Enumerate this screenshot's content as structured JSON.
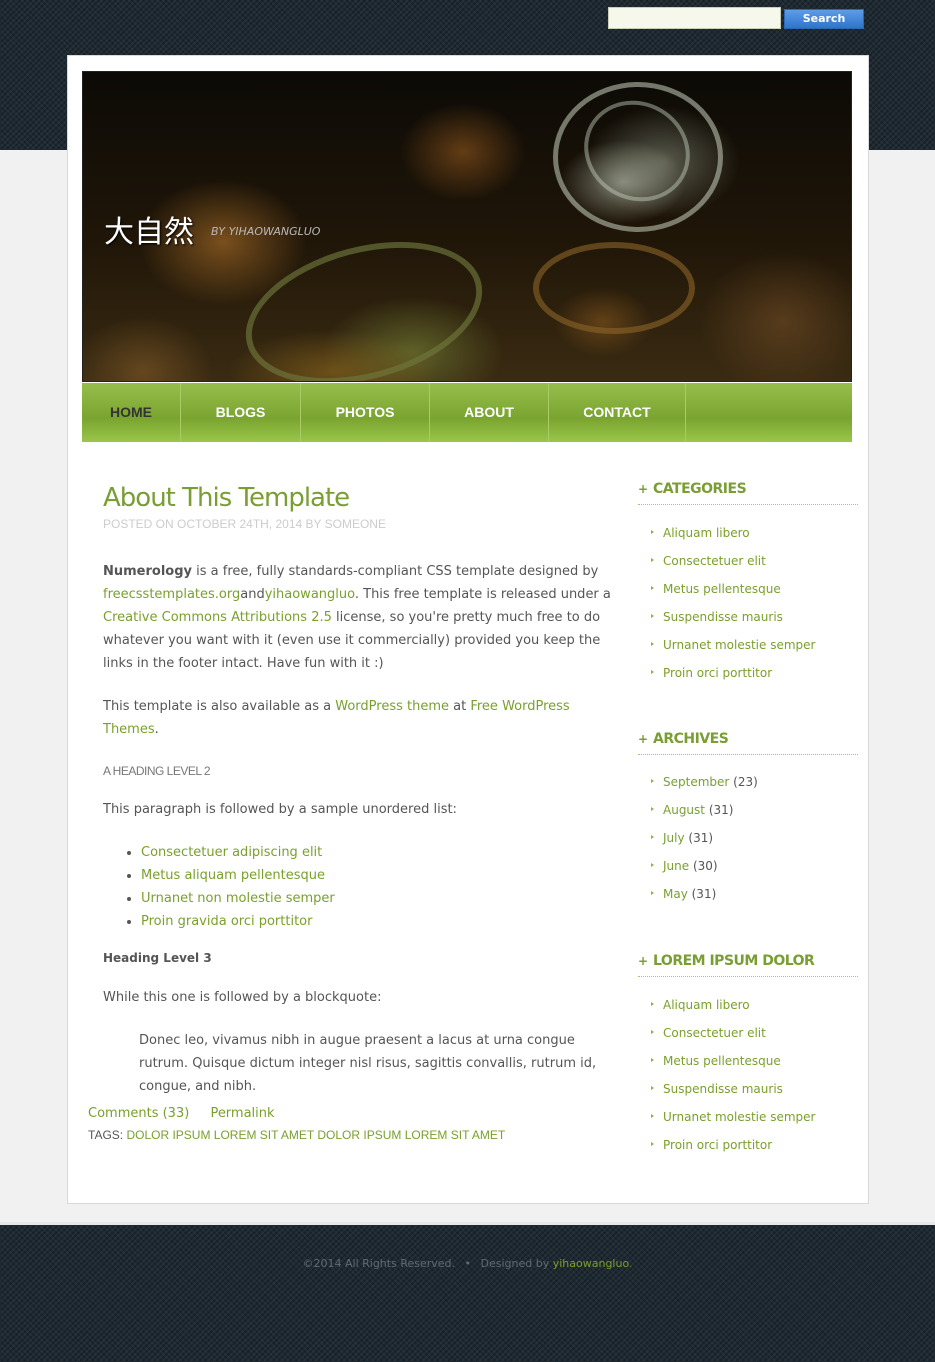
{
  "search": {
    "placeholder": "",
    "button_label": "Search"
  },
  "header": {
    "site_title": "大自然",
    "byline": "BY YIHAOWANGLUO"
  },
  "nav": {
    "items": [
      {
        "label": "HOME",
        "current": true
      },
      {
        "label": "BLOGS",
        "current": false
      },
      {
        "label": "PHOTOS",
        "current": false
      },
      {
        "label": "ABOUT",
        "current": false
      },
      {
        "label": "CONTACT",
        "current": false
      }
    ]
  },
  "post": {
    "title": "About This Template",
    "byline": "POSTED ON OCTOBER 24TH, 2014 BY SOMEONE",
    "intro": {
      "name": "Numerology",
      "text1": " is a free, fully standards-compliant CSS template designed by ",
      "link1": "freecsstemplates.org",
      "text2": "and",
      "link2": "yihaowangluo",
      "text3": ". This free template is released under a ",
      "link3": "Creative Commons Attributions 2.5",
      "text4": " license, so you're pretty much free to do whatever you want with it (even use it commercially) provided you keep the links in the footer intact. Have fun with it :)"
    },
    "wp": {
      "text1": "This template is also available as a ",
      "link1": "WordPress theme",
      "text2": " at ",
      "link2": "Free WordPress Themes",
      "text3": "."
    },
    "heading2": "A HEADING LEVEL 2",
    "list_intro": "This paragraph is followed by a sample unordered list:",
    "list": [
      "Consectetuer adipiscing elit",
      "Metus aliquam pellentesque",
      "Urnanet non molestie semper",
      "Proin gravida orci porttitor"
    ],
    "heading3": "Heading Level 3",
    "quote_intro": "While this one is followed by a blockquote:",
    "blockquote": "Donec leo, vivamus nibh in augue praesent a lacus at urna congue rutrum. Quisque dictum integer nisl risus, sagittis convallis, rutrum id, congue, and nibh.",
    "comments": "Comments (33)",
    "permalink": "Permalink",
    "tags_label": "TAGS: ",
    "tags": "DOLOR IPSUM LOREM SIT AMET DOLOR IPSUM LOREM SIT AMET"
  },
  "sidebar": {
    "categories": {
      "title": "CATEGORIES",
      "items": [
        "Aliquam libero",
        "Consectetuer elit",
        "Metus pellentesque",
        "Suspendisse mauris",
        "Urnanet molestie semper",
        "Proin orci porttitor"
      ]
    },
    "archives": {
      "title": "ARCHIVES",
      "items": [
        {
          "month": "September",
          "count": " (23)"
        },
        {
          "month": "August",
          "count": " (31)"
        },
        {
          "month": "July",
          "count": " (31)"
        },
        {
          "month": "June",
          "count": " (30)"
        },
        {
          "month": "May",
          "count": " (31)"
        }
      ]
    },
    "lorem": {
      "title": "LOREM IPSUM DOLOR",
      "items": [
        "Aliquam libero",
        "Consectetuer elit",
        "Metus pellentesque",
        "Suspendisse mauris",
        "Urnanet molestie semper",
        "Proin orci porttitor"
      ]
    }
  },
  "footer": {
    "copyright": "©2014 All Rights Reserved.",
    "separator": "•",
    "designed_by": "Designed by ",
    "designer": "yihaowangluo",
    "end": "."
  },
  "colors": {
    "accent": "#7a9e34",
    "nav": "#8cb63f",
    "dark_bg": "#1f2a33",
    "search_button": "#3a7fd5"
  }
}
